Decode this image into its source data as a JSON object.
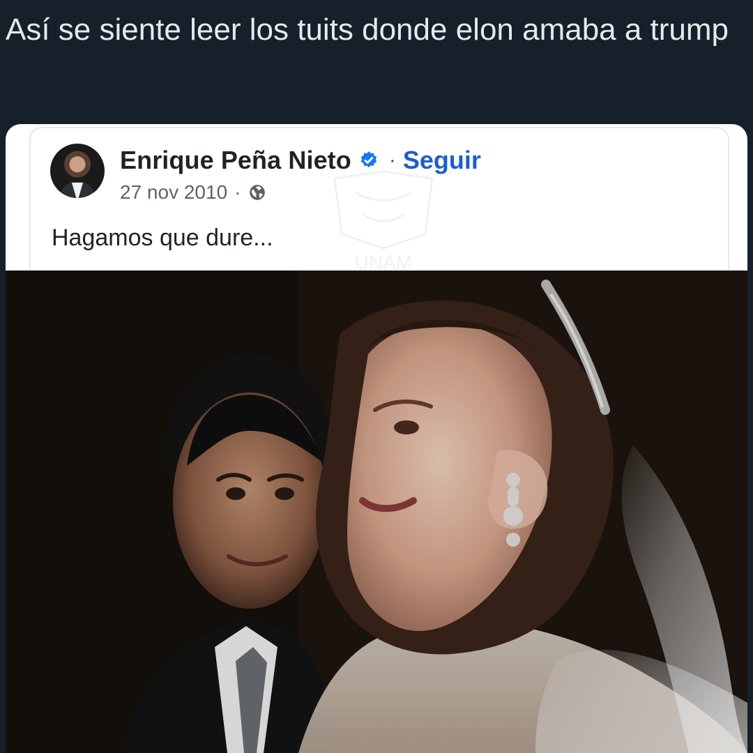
{
  "caption": {
    "text": "Así se siente leer los tuits donde elon amaba a trump"
  },
  "post": {
    "author_name": "Enrique Peña Nieto",
    "verified_icon": "verified-badge-icon",
    "separator": "·",
    "follow_label": "Seguir",
    "date": "27 nov 2010",
    "date_separator": "·",
    "privacy_icon": "globe-icon",
    "text": "Hagamos que dure...",
    "watermark_text": "UNAM",
    "image": "wedding-couple-photo"
  },
  "colors": {
    "page_background": "#15202b",
    "caption_text": "#e7e9ea",
    "card_background": "#ffffff",
    "follow_link": "#1f5ec9",
    "verified_badge": "#1877f2"
  }
}
